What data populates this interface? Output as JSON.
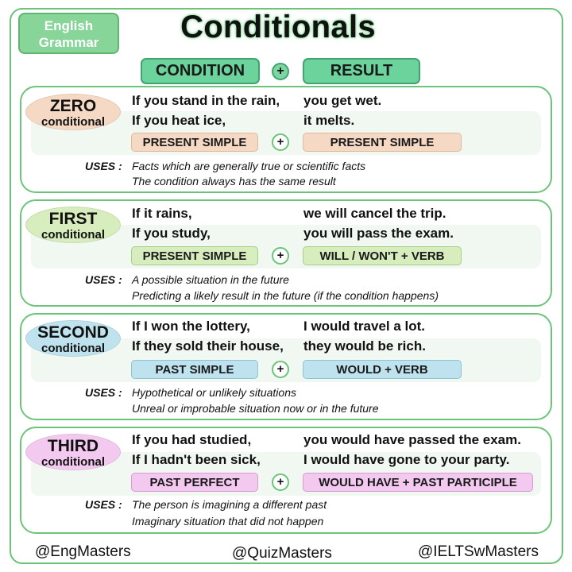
{
  "badge": {
    "line1": "English",
    "line2": "Grammar"
  },
  "title": "Conditionals",
  "header": {
    "condition": "CONDITION",
    "plus": "+",
    "result": "RESULT"
  },
  "colors": {
    "green": "#6cc47a",
    "zero": "#f5d9c4",
    "first": "#d7edbd",
    "second": "#bfe3ee",
    "third": "#f3c9f0"
  },
  "sections": [
    {
      "label_big": "ZERO",
      "label_small": "conditional",
      "rows": [
        {
          "condition": "If you stand in the rain,",
          "result": "you get wet."
        },
        {
          "condition": "If you heat ice,",
          "result": "it melts."
        }
      ],
      "condition_form": "PRESENT SIMPLE",
      "plus": "+",
      "result_form": "PRESENT SIMPLE",
      "uses_label": "USES :",
      "uses": [
        "Facts which are generally true or scientific facts",
        "The condition always has the same result"
      ]
    },
    {
      "label_big": "FIRST",
      "label_small": "conditional",
      "rows": [
        {
          "condition": "If it rains,",
          "result": "we will cancel the trip."
        },
        {
          "condition": "If you study,",
          "result": "you will pass the exam."
        }
      ],
      "condition_form": "PRESENT SIMPLE",
      "plus": "+",
      "result_form": "WILL / WON'T + VERB",
      "uses_label": "USES :",
      "uses": [
        "A possible situation in the future",
        "Predicting a likely result in the future (if the condition happens)"
      ]
    },
    {
      "label_big": "SECOND",
      "label_small": "conditional",
      "rows": [
        {
          "condition": "If I won the lottery,",
          "result": "I would travel a lot."
        },
        {
          "condition": "If they sold their house,",
          "result": "they would be rich."
        }
      ],
      "condition_form": "PAST SIMPLE",
      "plus": "+",
      "result_form": "WOULD + VERB",
      "uses_label": "USES :",
      "uses": [
        "Hypothetical or unlikely situations",
        "Unreal or improbable situation now or in the future"
      ]
    },
    {
      "label_big": "THIRD",
      "label_small": "conditional",
      "rows": [
        {
          "condition": "If you had studied,",
          "result": "you would have passed the exam."
        },
        {
          "condition": "If I hadn't been sick,",
          "result": "I would have gone to your party."
        }
      ],
      "condition_form": "PAST PERFECT",
      "plus": "+",
      "result_form": "WOULD HAVE + PAST PARTICIPLE",
      "uses_label": "USES :",
      "uses": [
        "The person is imagining a different past",
        "Imaginary situation that did not happen"
      ]
    }
  ],
  "footer": {
    "left": "@EngMasters",
    "center": "@QuizMasters",
    "right": "@IELTSwMasters"
  }
}
